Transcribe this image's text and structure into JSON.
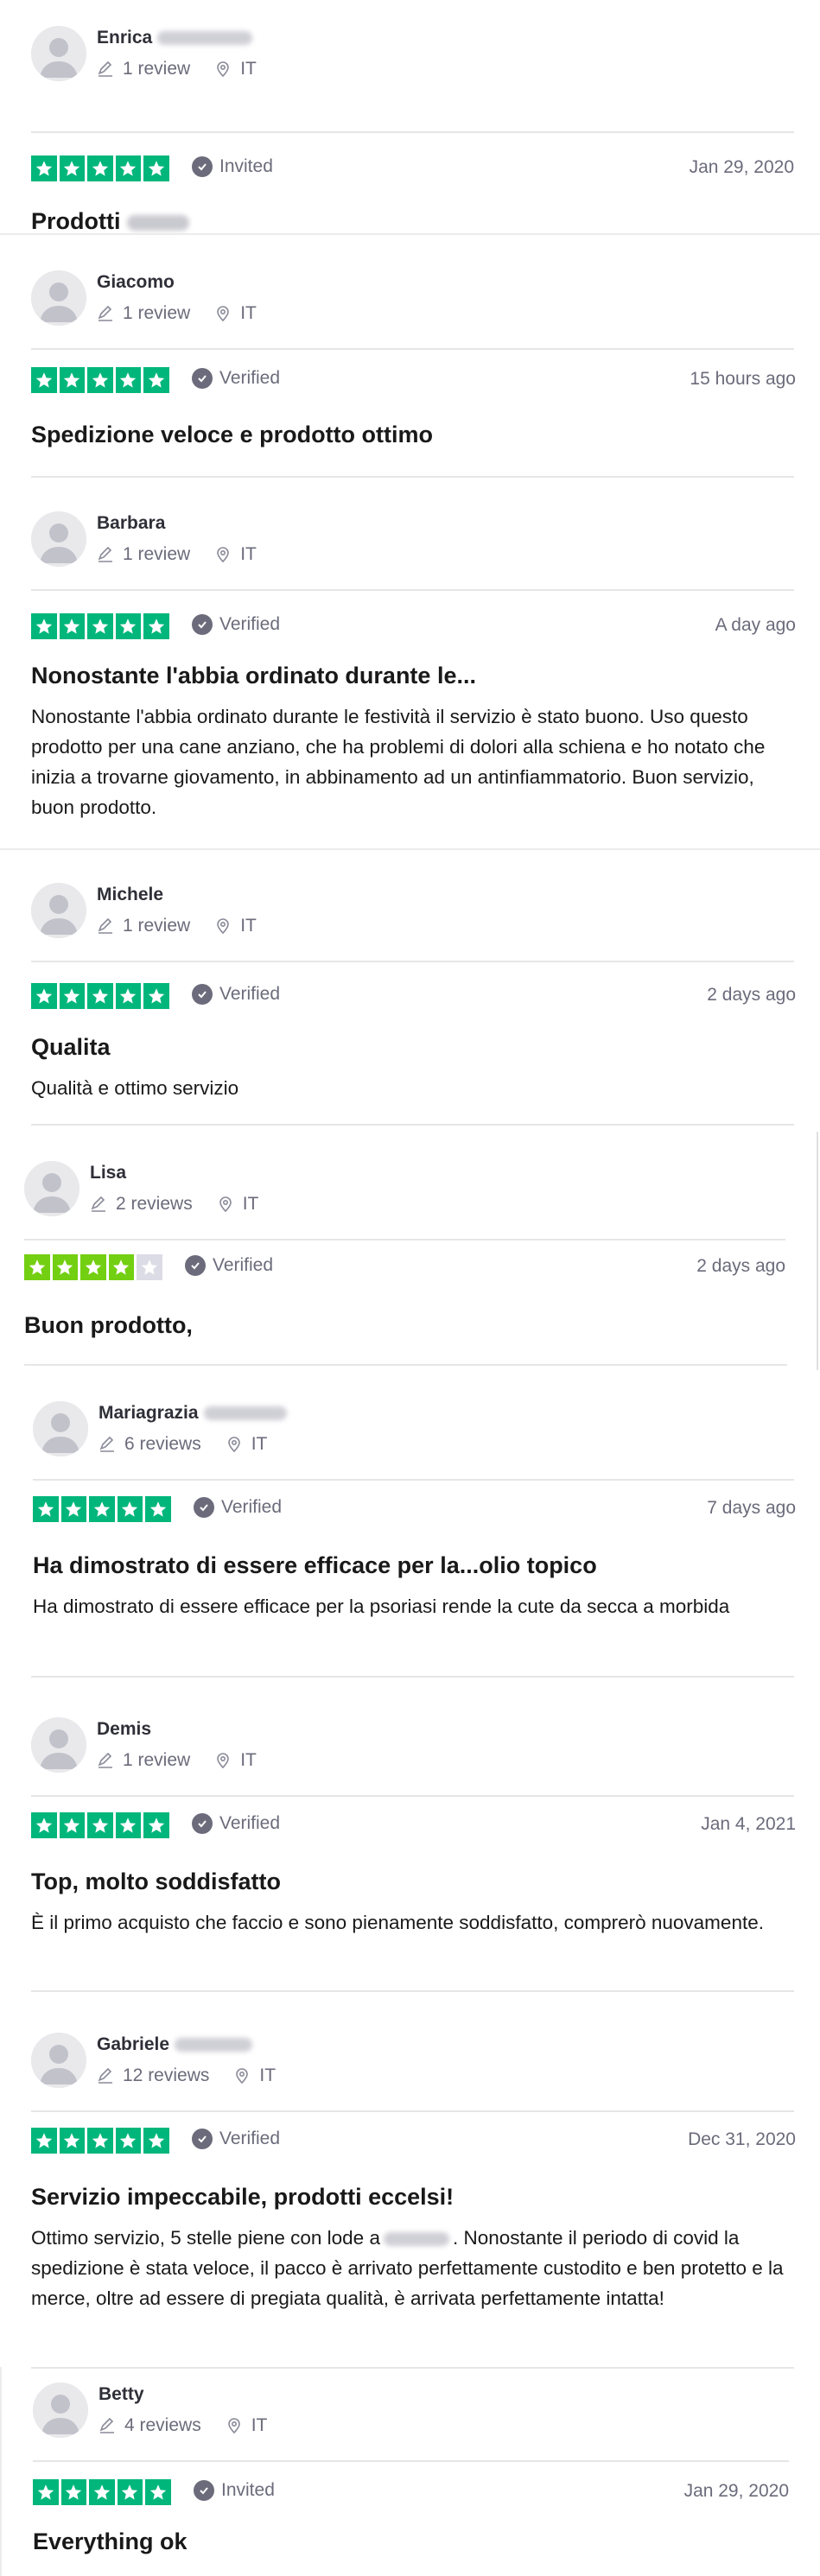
{
  "reviews": [
    {
      "name": "Enrica",
      "review_count": "1 review",
      "country": "IT",
      "stars": 5,
      "badge": "Invited",
      "date": "Jan 29, 2020",
      "title": "Prodotti",
      "body": ""
    },
    {
      "name": "Giacomo",
      "review_count": "1 review",
      "country": "IT",
      "stars": 5,
      "badge": "Verified",
      "date": "15 hours ago",
      "title": "Spedizione veloce e prodotto ottimo",
      "body": ""
    },
    {
      "name": "Barbara",
      "review_count": "1 review",
      "country": "IT",
      "stars": 5,
      "badge": "Verified",
      "date": "A day ago",
      "title": "Nonostante l'abbia ordinato durante le...",
      "body": "Nonostante l'abbia ordinato durante le festività il servizio è stato buono. Uso questo prodotto per una cane anziano, che ha problemi di dolori alla schiena e ho notato che inizia a trovarne giovamento, in abbinamento ad un antinfiammatorio. Buon servizio, buon prodotto."
    },
    {
      "name": "Michele",
      "review_count": "1 review",
      "country": "IT",
      "stars": 5,
      "badge": "Verified",
      "date": "2 days ago",
      "title": "Qualita",
      "body": "Qualità e ottimo servizio"
    },
    {
      "name": "Lisa",
      "review_count": "2 reviews",
      "country": "IT",
      "stars": 4,
      "badge": "Verified",
      "date": "2 days ago",
      "title": "Buon prodotto,",
      "body": ""
    },
    {
      "name": "Mariagrazia",
      "review_count": "6 reviews",
      "country": "IT",
      "stars": 5,
      "badge": "Verified",
      "date": "7 days ago",
      "title": "Ha dimostrato di essere efficace per la...olio topico",
      "body": "Ha dimostrato di essere efficace per la psoriasi rende la cute da secca a morbida"
    },
    {
      "name": "Demis",
      "review_count": "1 review",
      "country": "IT",
      "stars": 5,
      "badge": "Verified",
      "date": "Jan 4, 2021",
      "title": "Top, molto soddisfatto",
      "body": "È il primo acquisto che faccio e sono pienamente soddisfatto, comprerò nuovamente."
    },
    {
      "name": "Gabriele",
      "review_count": "12 reviews",
      "country": "IT",
      "stars": 5,
      "badge": "Verified",
      "date": "Dec 31, 2020",
      "title": "Servizio impeccabile, prodotti eccelsi!",
      "body_before": "Ottimo servizio, 5 stelle piene con lode a",
      "body_after": ". Nonostante il periodo di covid la spedizione è stata veloce, il pacco è arrivato perfettamente custodito e ben protetto e la merce, oltre ad essere di pregiata qualità, è arrivata perfettamente intatta!"
    },
    {
      "name": "Betty",
      "review_count": "4 reviews",
      "country": "IT",
      "stars": 5,
      "badge": "Invited",
      "date": "Jan 29, 2020",
      "title": "Everything ok",
      "body": ""
    }
  ],
  "colors": {
    "star_full": "#00b67a",
    "star_four": "#73cf11",
    "star_empty": "#dcdce6",
    "muted_text": "#6b6b7b"
  },
  "icons": {
    "avatar": "user-silhouette-icon",
    "reviews": "pencil-icon",
    "location": "map-pin-icon",
    "badge": "checkmark-icon",
    "star": "star-icon"
  }
}
